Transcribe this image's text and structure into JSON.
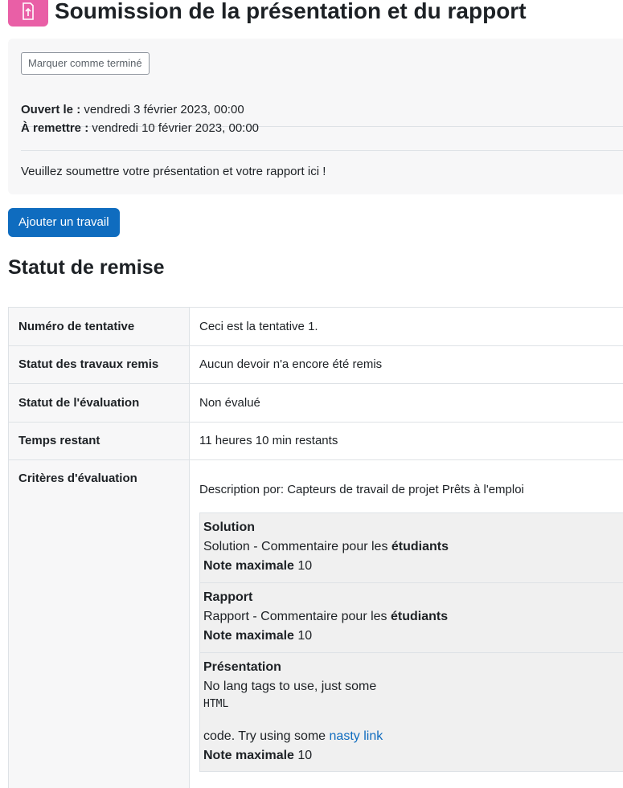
{
  "header": {
    "title": "Soumission de la présentation et du rapport",
    "icon": "assignment-upload-icon",
    "icon_color": "#e95fa6"
  },
  "info": {
    "mark_done_label": "Marquer comme terminé",
    "opened_label": "Ouvert le :",
    "opened_value": "vendredi 3 février 2023, 00:00",
    "due_label": "À remettre :",
    "due_value": "vendredi 10 février 2023, 00:00",
    "intro": "Veuillez soumettre votre présentation et votre rapport ici !"
  },
  "actions": {
    "add_submission_label": "Ajouter un travail",
    "primary_color": "#0f6cbf"
  },
  "status_section": {
    "heading": "Statut de remise",
    "rows": [
      {
        "label": "Numéro de tentative",
        "value": "Ceci est la tentative 1."
      },
      {
        "label": "Statut des travaux remis",
        "value": "Aucun devoir n'a encore été remis"
      },
      {
        "label": "Statut de l'évaluation",
        "value": "Non évalué"
      },
      {
        "label": "Temps restant",
        "value": "11 heures 10 min restants"
      }
    ],
    "criteria": {
      "label": "Critères d'évaluation",
      "description": "Description por: Capteurs de travail de projet Prêts à l'emploi",
      "items": [
        {
          "title": "Solution",
          "comment_prefix": "Solution - Commentaire pour les",
          "comment_bold": "étudiants",
          "max_label": "Note maximale",
          "max_value": "10"
        },
        {
          "title": "Rapport",
          "comment_prefix": "Rapport - Commentaire pour les",
          "comment_bold": "étudiants",
          "max_label": "Note maximale",
          "max_value": "10"
        },
        {
          "title": "Présentation",
          "line1": "No lang tags to use, just some",
          "code": "HTML",
          "line2_prefix": "code. Try using some",
          "link": "nasty link",
          "max_label": "Note maximale",
          "max_value": "10"
        }
      ]
    }
  }
}
